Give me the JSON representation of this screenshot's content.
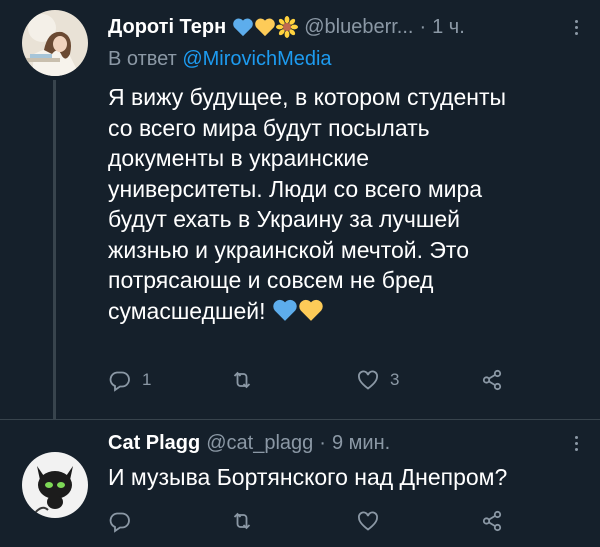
{
  "tweets": [
    {
      "author_name": "Дороті Терн",
      "handle": "@blueberr...",
      "separator": "·",
      "time": "1 ч.",
      "reply_prefix": "В ответ",
      "reply_mention": "@MirovichMedia",
      "text": "Я вижу будущее, в котором студенты\nсо всего мира будут посылать\nдокументы в украинские\nуниверситеты. Люди со всего мира\nбудут ехать в Украину за лучшей\nжизнью и украинской мечтой. Это\nпотрясающе и совсем не бред\nсумасшедшей!",
      "actions": {
        "replies": "1",
        "retweets": "",
        "likes": "3"
      }
    },
    {
      "author_name": "Cat Plagg",
      "handle": "@cat_plagg",
      "separator": "·",
      "time": "9 мин.",
      "text": "И музыва Бортянского над Днепром?",
      "actions": {
        "replies": "",
        "retweets": "",
        "likes": ""
      }
    }
  ],
  "colors": {
    "background": "#15202b",
    "muted": "#8b98a5",
    "accent": "#1d9bf0",
    "divider": "#38444d"
  },
  "icons": [
    "blue-heart-icon",
    "yellow-heart-icon",
    "sunflower-icon",
    "reply-icon",
    "retweet-icon",
    "like-icon",
    "share-icon",
    "more-icon"
  ]
}
